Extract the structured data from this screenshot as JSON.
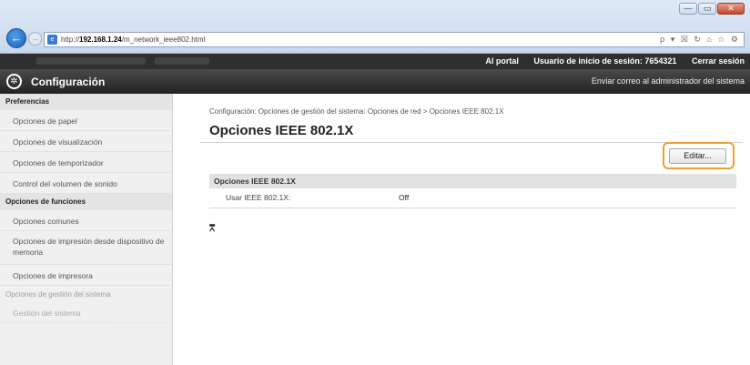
{
  "window": {
    "controls": [
      "—",
      "▭",
      "✕"
    ]
  },
  "browser": {
    "back_icon": "←",
    "forward_icon": "→",
    "url_prefix": "http://",
    "url_host": "192.168.1.24",
    "url_path": "/m_network_ieee802.html",
    "tools": "ρ ▾ ☒ ↻   ⌂ ☆ ⚙"
  },
  "topbar": {
    "portal_link": "Al portal",
    "login_label": "Usuario de inicio de sesión: 7654321",
    "logout_link": "Cerrar sesión"
  },
  "header": {
    "title": "Configuración",
    "mail_link": "Enviar correo al administrador del sistema"
  },
  "sidebar": {
    "section1_title": "Preferencias",
    "items1": [
      "Opciones de papel",
      "Opciones de visualización",
      "Opciones de temporizador",
      "Control del volumen de sonido"
    ],
    "section2_title": "Opciones de funciones",
    "items2": [
      "Opciones comunes",
      "Opciones de impresión desde dispositivo de memoria",
      "Opciones de impresora"
    ],
    "section3_title": "Opciones de gestión del sistema",
    "items3": [
      "Gestión del sistema"
    ]
  },
  "main": {
    "breadcrumb": "Configuración: Opciones de gestión del sistema: Opciones de red > Opciones IEEE 802.1X",
    "title": "Opciones IEEE 802.1X",
    "edit_button": "Editar...",
    "section_title": "Opciones IEEE 802.1X",
    "setting_label": "Usar IEEE 802.1X:",
    "setting_value": "Off",
    "top_link": "⩞"
  },
  "colors": {
    "highlight_ring": "#f0a030",
    "header_dark": "#2f2f2f"
  }
}
